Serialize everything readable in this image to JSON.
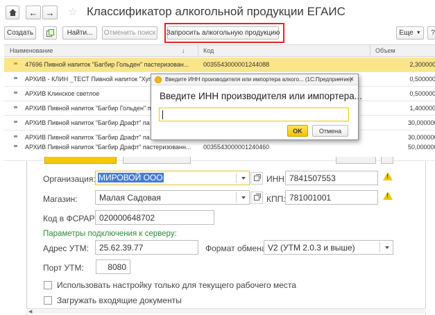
{
  "window": {
    "title": "Классификатор алкогольной продукции ЕГАИС"
  },
  "toolbar": {
    "create": "Создать",
    "find": "Найти...",
    "cancel_search": "Отменить поиск",
    "request": "Запросить алкогольную продукцию",
    "more": "Еще",
    "help": "?"
  },
  "table": {
    "headers": [
      "Наименование",
      "Код",
      "Объем"
    ],
    "rows": [
      {
        "name": "47696 Пивной напиток \"Багбир Гольден\" пастеризован...",
        "code": "0035543000001244088",
        "volume": "2,300000",
        "selected": true
      },
      {
        "name": "АРХИВ - КЛИН _ТЕСТ Пивной напиток \"Хуга",
        "code": "",
        "volume": "0,500000",
        "selected": false
      },
      {
        "name": "АРХИВ Клинское светлое",
        "code": "",
        "volume": "0,500000",
        "selected": false
      },
      {
        "name": "АРХИВ Пивной напиток \"Багбир Гольден\" п",
        "code": "",
        "volume": "1,400000",
        "selected": false
      },
      {
        "name": "АРХИВ Пивной напиток \"Багбир Драфт\" па",
        "code": "",
        "volume": "30,000000",
        "selected": false
      },
      {
        "name": "АРХИВ Пивной напиток \"Багбир Драфт\" па",
        "code": "",
        "volume": "30,000000",
        "selected": false
      },
      {
        "name": "АРХИВ Пивной напиток \"Багбир Драфт\" пастеризованн...",
        "code": "0035543000001240460",
        "volume": "50,000000",
        "selected": false
      }
    ]
  },
  "dialog": {
    "title": "Введите ИНН производителя или импортера алкого... (1С:Предприятие)",
    "prompt": "Введите ИНН производителя или импортера...",
    "input_value": "",
    "ok": "OK",
    "cancel": "Отмена"
  },
  "form": {
    "org_label": "Организация:",
    "org_value": "МИРОВОЙ ООО",
    "inn_label": "ИНН:",
    "inn_value": "7841507553",
    "shop_label": "Магазин:",
    "shop_value": "Малая Садовая",
    "kpp_label": "КПП:",
    "kpp_value": "781001001",
    "fsrar_label": "Код в ФСРАР:",
    "fsrar_value": "020000648702",
    "section_title": "Параметры подключения к серверу:",
    "utm_addr_label": "Адрес УТМ:",
    "utm_addr_value": "25.62.39.77",
    "format_label": "Формат обмена:",
    "format_value": "V2 (УТМ 2.0.3 и выше)",
    "port_label": "Порт УТМ:",
    "port_value": "8080",
    "chk1_label": "Использовать настройку только для текущего рабочего места",
    "chk2_label": "Загружать входящие документы"
  }
}
